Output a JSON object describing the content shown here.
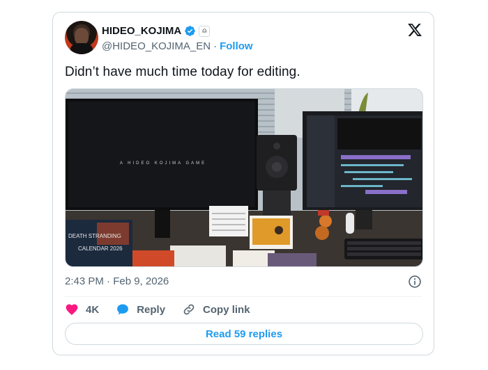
{
  "author": {
    "name": "HIDEO_KOJIMA",
    "handle": "@HIDEO_KOJIMA_EN",
    "separator": "·",
    "follow_label": "Follow",
    "verified_icon": "verified-badge-icon",
    "affiliate_icon": "affiliate-badge-icon",
    "affiliate_glyph": "⍝"
  },
  "tweet": {
    "text": "Didn’t have much time today for editing.",
    "time": "2:43 PM · Feb 9, 2026"
  },
  "media": {
    "screen_text": "A HIDEO KOJIMA GAME",
    "calendar_text_1": "DEATH STRANDING",
    "calendar_text_2": "CALENDAR 2026"
  },
  "actions": {
    "likes": "4K",
    "reply_label": "Reply",
    "copy_link_label": "Copy link",
    "read_replies_label": "Read 59 replies"
  },
  "colors": {
    "accent": "#1d9bf0",
    "like": "#f91880",
    "text": "#0f1419",
    "muted": "#536471",
    "border": "#cfd9de"
  }
}
